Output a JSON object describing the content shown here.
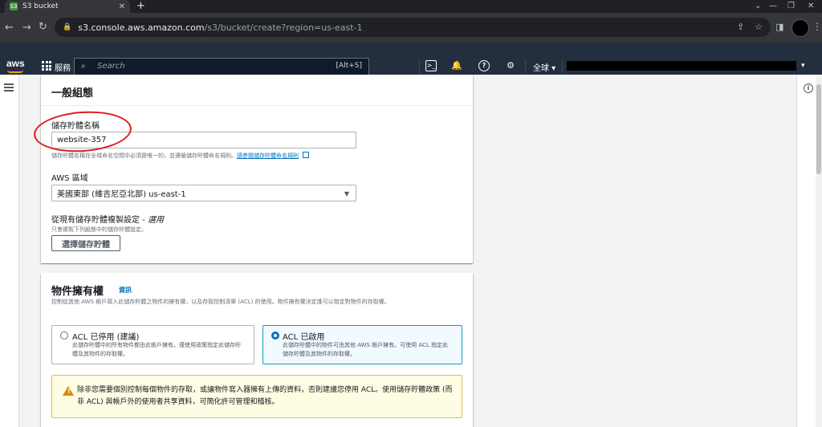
{
  "browser": {
    "tab_title": "S3 bucket",
    "tab_favicon": "S3",
    "close_glyph": "✕",
    "newtab_glyph": "+",
    "url_domain": "s3.console.aws.amazon.com",
    "url_path": "/s3/bucket/create?region=us-east-1"
  },
  "aws_nav": {
    "logo": "aws",
    "services_label": "服務",
    "search_placeholder": "Search",
    "search_shortcut": "[Alt+S]",
    "region_label": "全球 ▾"
  },
  "general_config": {
    "title": "一般組態",
    "bucket_name_label": "儲存貯體名稱",
    "bucket_name_value": "website-357",
    "bucket_name_help": "儲存貯體名稱在全域命名空間中必須是唯一的，並遵循儲存貯體命名規則。",
    "naming_rules_link": "請參閱儲存貯體命名規則",
    "region_label": "AWS 區域",
    "region_value": "美國東部 (維吉尼亞北部) us-east-1",
    "copy_label": "從現有儲存貯體複製設定 - ",
    "copy_optional": "選用",
    "copy_help": "只會複製下列組態中的儲存貯體設定。",
    "choose_bucket_button": "選擇儲存貯體"
  },
  "object_ownership": {
    "title": "物件擁有權",
    "info_link": "資訊",
    "description": "控制從其他 AWS 帳戶寫入此儲存貯體之物件的擁有權，以及存取控制清單 (ACL) 的使用。物件擁有權決定誰可以指定對物件的存取權。",
    "option_disabled_title": "ACL 已停用 (建議)",
    "option_disabled_desc": "此儲存貯體中的所有物件都由此帳戶擁有。僅使用政策指定此儲存貯體及其物件的存取權。",
    "option_enabled_title": "ACL 已啟用",
    "option_enabled_desc": "此儲存貯體中的物件可由其他 AWS 帳戶擁有。可使用 ACL 指定此儲存貯體及其物件的存取權。",
    "warning_text": "除非您需要個別控制每個物件的存取，或讓物件寫入器擁有上傳的資料，否則建議您停用 ACL。使用儲存貯體政策 (而非 ACL) 與帳戶外的使用者共享資料，可簡化許可管理和稽核。"
  },
  "colors": {
    "aws_nav_bg": "#232f3e",
    "aws_orange": "#ff9900",
    "link_blue": "#0073bb",
    "annotation_red": "#e0191e",
    "warning_bg": "#fffce4"
  },
  "icons": [
    "back-arrow-icon",
    "forward-arrow-icon",
    "reload-icon",
    "lock-icon",
    "share-icon",
    "star-icon",
    "sidepanel-icon",
    "services-grid-icon",
    "search-icon",
    "cloudshell-icon",
    "bell-icon",
    "help-icon",
    "settings-icon",
    "menu-icon",
    "info-icon",
    "external-link-icon",
    "warning-icon"
  ]
}
